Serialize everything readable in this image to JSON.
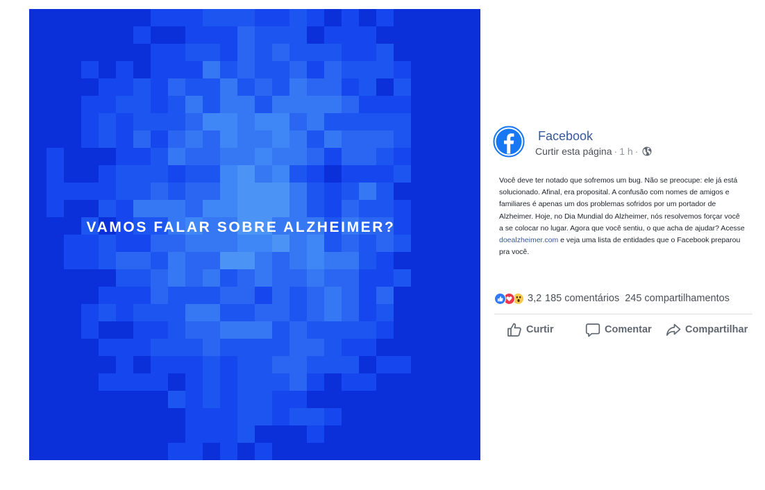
{
  "image": {
    "headline": "VAMOS FALAR SOBRE ALZHEIMER?",
    "palette": [
      "#0b2fd9",
      "#1646ee",
      "#1d55f0",
      "#2a66f2",
      "#3678f4",
      "#3f86f6",
      "#4c93f6"
    ]
  },
  "post": {
    "page_name": "Facebook",
    "like_page_label": "Curtir esta página",
    "separator": "·",
    "time": "1 h",
    "audience_icon": "globe-icon",
    "text_before_link": "Você deve ter notado que sofremos um bug. Não se preocupe: ele já está solucionado. Afinal, era proposital. A confusão com nomes de amigos e familiares é apenas um dos problemas sofridos por um portador de Alzheimer. Hoje, no Dia Mundial do Alzheimer, nós resolvemos forçar você a se colocar no lugar. Agora que você sentiu, o que acha de ajudar? Acesse ",
    "link_text": "doealzheimer.com",
    "text_after_link": " e veja uma lista de entidades que o Facebook preparou pra você.",
    "reactions": {
      "icons": [
        "like-icon",
        "love-icon",
        "wow-icon"
      ],
      "count": "3,2",
      "comments": "185 comentários",
      "shares": "245 compartilhamentos"
    },
    "actions": {
      "like": "Curtir",
      "comment": "Comentar",
      "share": "Compartilhar"
    }
  },
  "colors": {
    "link": "#385898",
    "page_name": "#365899",
    "brand_blue": "#1877f2"
  }
}
